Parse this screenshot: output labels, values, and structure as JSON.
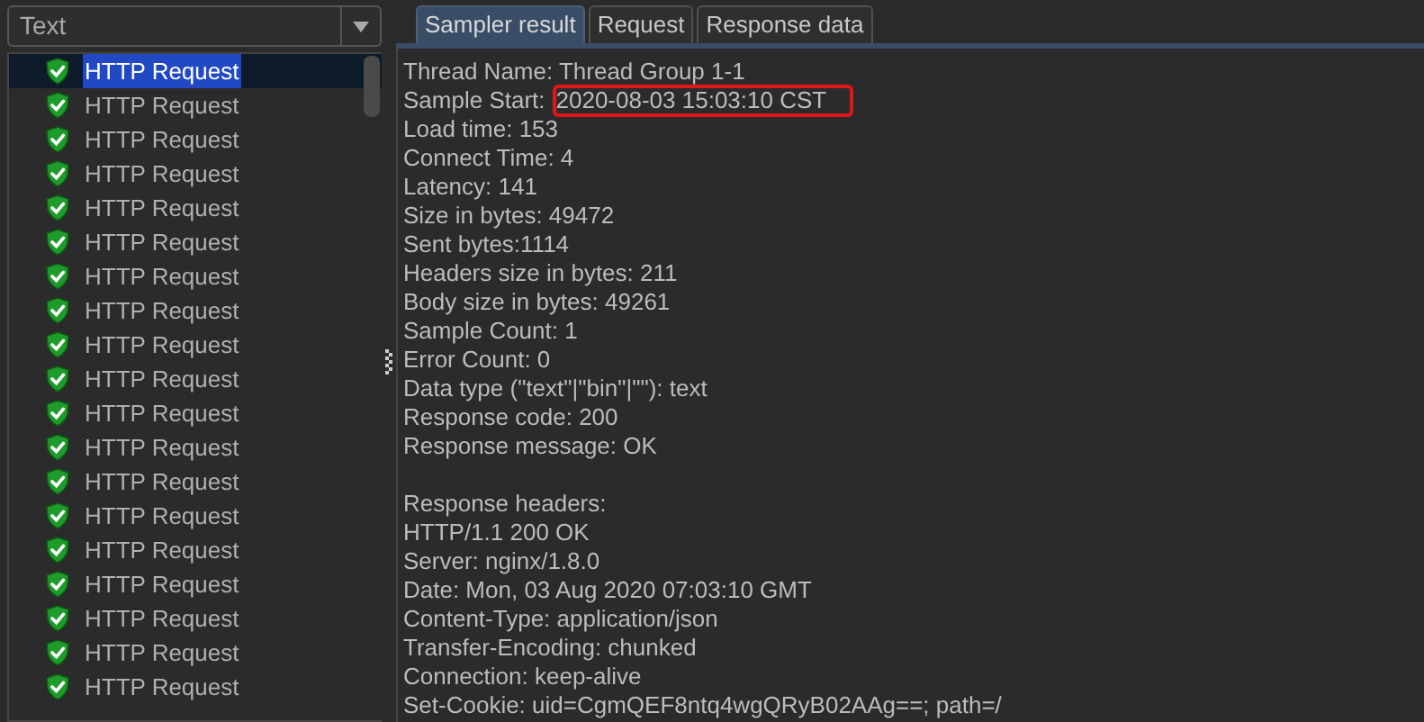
{
  "filter": {
    "value": "Text"
  },
  "results": [
    {
      "label": "HTTP Request",
      "selected": true
    },
    {
      "label": "HTTP Request",
      "selected": false
    },
    {
      "label": "HTTP Request",
      "selected": false
    },
    {
      "label": "HTTP Request",
      "selected": false
    },
    {
      "label": "HTTP Request",
      "selected": false
    },
    {
      "label": "HTTP Request",
      "selected": false
    },
    {
      "label": "HTTP Request",
      "selected": false
    },
    {
      "label": "HTTP Request",
      "selected": false
    },
    {
      "label": "HTTP Request",
      "selected": false
    },
    {
      "label": "HTTP Request",
      "selected": false
    },
    {
      "label": "HTTP Request",
      "selected": false
    },
    {
      "label": "HTTP Request",
      "selected": false
    },
    {
      "label": "HTTP Request",
      "selected": false
    },
    {
      "label": "HTTP Request",
      "selected": false
    },
    {
      "label": "HTTP Request",
      "selected": false
    },
    {
      "label": "HTTP Request",
      "selected": false
    },
    {
      "label": "HTTP Request",
      "selected": false
    },
    {
      "label": "HTTP Request",
      "selected": false
    },
    {
      "label": "HTTP Request",
      "selected": false
    }
  ],
  "tabs": [
    {
      "label": "Sampler result",
      "selected": true
    },
    {
      "label": "Request",
      "selected": false
    },
    {
      "label": "Response data",
      "selected": false
    }
  ],
  "result_lines": [
    {
      "text": "Thread Name: Thread Group 1-1"
    },
    {
      "text": "Sample Start:",
      "value": "2020-08-03 15:03:10 CST",
      "highlighted": true
    },
    {
      "text": "Load time: 153"
    },
    {
      "text": "Connect Time: 4"
    },
    {
      "text": "Latency: 141"
    },
    {
      "text": "Size in bytes: 49472"
    },
    {
      "text": "Sent bytes:1114"
    },
    {
      "text": "Headers size in bytes: 211"
    },
    {
      "text": "Body size in bytes: 49261"
    },
    {
      "text": "Sample Count: 1"
    },
    {
      "text": "Error Count: 0"
    },
    {
      "text": "Data type (\"text\"|\"bin\"|\"\"): text"
    },
    {
      "text": "Response code: 200"
    },
    {
      "text": "Response message: OK"
    }
  ],
  "header_lines": [
    "Response headers:",
    "HTTP/1.1 200 OK",
    "Server: nginx/1.8.0",
    "Date: Mon, 03 Aug 2020 07:03:10 GMT",
    "Content-Type: application/json",
    "Transfer-Encoding: chunked",
    "Connection: keep-alive",
    "Set-Cookie: uid=CgmQEF8ntq4wgQRyB02AAg==; path=/"
  ]
}
